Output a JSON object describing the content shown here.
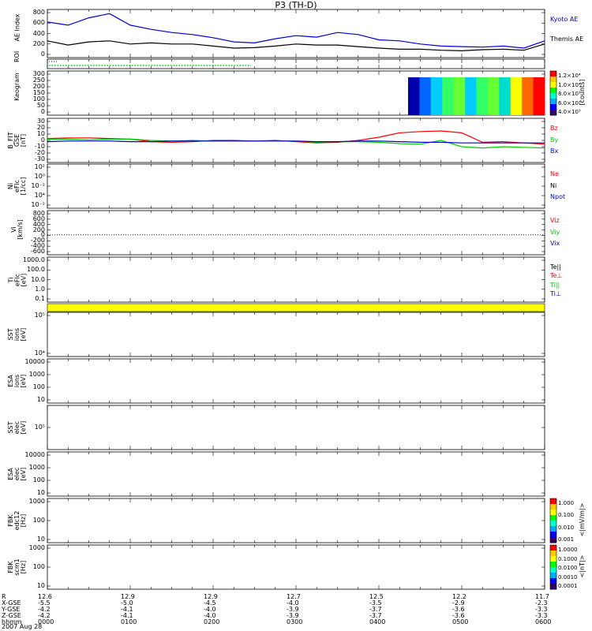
{
  "title": "P3 (TH-D)",
  "date": "2007 Aug 28",
  "colors": {
    "blue": "#0000cc",
    "green": "#00cc00",
    "red": "#ff0000",
    "black": "#000000",
    "yellow": "#ffff00"
  },
  "panels": [
    {
      "id": "ae",
      "ylabel": [
        "AE Index"
      ],
      "ticks": [
        "800",
        "600",
        "400",
        "200",
        "0"
      ],
      "legend": [
        {
          "text": "Kyoto AE",
          "color": "blue"
        },
        {
          "text": "Themis AE",
          "color": "black"
        }
      ]
    },
    {
      "id": "roi",
      "ylabel": [
        "ROI"
      ],
      "ticks": [],
      "legend": []
    },
    {
      "id": "keogram",
      "ylabel": [
        "Keogram"
      ],
      "ticks": [
        "300",
        "250",
        "200",
        "150",
        "100",
        "50",
        "0"
      ],
      "legend": [],
      "colorbar": {
        "label": "[counts]",
        "ticks": [
          "1.2×10⁴",
          "1.0×10⁴",
          "8.0×10³",
          "6.0×10³",
          "4.0×10³"
        ]
      }
    },
    {
      "id": "bfit",
      "ylabel": [
        "B_FIT",
        "GSE",
        "[nT]"
      ],
      "ticks": [
        "30",
        "20",
        "10",
        "0",
        "-10",
        "-20",
        "-30"
      ],
      "legend": [
        {
          "text": "Bz",
          "color": "red"
        },
        {
          "text": "By",
          "color": "green"
        },
        {
          "text": "Bx",
          "color": "blue"
        }
      ]
    },
    {
      "id": "ni",
      "ylabel": [
        "Ni",
        "eFlc",
        "[1/cc]"
      ],
      "ticks": [
        "10²",
        "10⁰",
        "10⁻²",
        "10⁴",
        "10⁻²"
      ],
      "legend": [
        {
          "text": "Ne",
          "color": "red"
        },
        {
          "text": "Ni",
          "color": "black"
        },
        {
          "text": "Npot",
          "color": "blue"
        }
      ]
    },
    {
      "id": "vi",
      "ylabel": [
        "Vi",
        "[km/s]"
      ],
      "ticks": [
        "800",
        "600",
        "400",
        "200",
        "0",
        "-200",
        "-400",
        "-600"
      ],
      "legend": [
        {
          "text": "Viz",
          "color": "red"
        },
        {
          "text": "Viy",
          "color": "green"
        },
        {
          "text": "Vix",
          "color": "blue"
        }
      ]
    },
    {
      "id": "ti",
      "ylabel": [
        "Ti",
        "eFlc",
        "[eV]"
      ],
      "ticks": [
        "1000.0",
        "100.0",
        "10.0",
        "1.0",
        "0.1"
      ],
      "legend": [
        {
          "text": "Te||",
          "color": "black"
        },
        {
          "text": "Te⊥",
          "color": "red"
        },
        {
          "text": "Ti||",
          "color": "green"
        },
        {
          "text": "Ti⊥",
          "color": "blue"
        }
      ]
    },
    {
      "id": "sst1",
      "ylabel": [
        "SST",
        "ions",
        "[eV]"
      ],
      "ticks": [
        "10⁵",
        "10⁴"
      ],
      "legend": []
    },
    {
      "id": "esa1",
      "ylabel": [
        "ESA",
        "ions",
        "[eV]"
      ],
      "ticks": [
        "10000",
        "1000",
        "100",
        "10"
      ],
      "legend": []
    },
    {
      "id": "sst2",
      "ylabel": [
        "SST",
        "elec",
        "[eV]"
      ],
      "ticks": [
        "10⁵"
      ],
      "legend": []
    },
    {
      "id": "esa2",
      "ylabel": [
        "ESA",
        "elec",
        "[eV]"
      ],
      "ticks": [
        "10000",
        "1000",
        "100",
        "10"
      ],
      "legend": []
    },
    {
      "id": "fbk1",
      "ylabel": [
        "FBK",
        "edc12",
        "[Hz]"
      ],
      "ticks": [
        "1000",
        "100",
        "10"
      ],
      "legend": [],
      "colorbar": {
        "label": "<|mV/m|>",
        "ticks": [
          "1.000",
          "0.100",
          "0.010",
          "0.001"
        ]
      }
    },
    {
      "id": "fbk2",
      "ylabel": [
        "FBK",
        "scm1",
        "[Hz]"
      ],
      "ticks": [
        "1000",
        "100",
        "10"
      ],
      "legend": [],
      "colorbar": {
        "label": "<|nT|>",
        "ticks": [
          "1.0000",
          "0.1000",
          "0.0100",
          "0.0010",
          "0.0001"
        ]
      }
    }
  ],
  "xaxis": {
    "rowlabels": [
      "R",
      "X-GSE",
      "Y-GSE",
      "Z-GSE",
      "hhmm"
    ],
    "columns": [
      {
        "R": "12.6",
        "X": "-5.5",
        "Y": "-4.2",
        "Z": "-4.2",
        "t": "0000"
      },
      {
        "R": "12.9",
        "X": "-5.0",
        "Y": "-4.1",
        "Z": "-4.1",
        "t": "0100"
      },
      {
        "R": "12.9",
        "X": "-4.5",
        "Y": "-4.0",
        "Z": "-4.0",
        "t": "0200"
      },
      {
        "R": "12.7",
        "X": "-4.0",
        "Y": "-3.9",
        "Z": "-3.9",
        "t": "0300"
      },
      {
        "R": "12.5",
        "X": "-3.5",
        "Y": "-3.7",
        "Z": "-3.7",
        "t": "0400"
      },
      {
        "R": "12.2",
        "X": "-2.9",
        "Y": "-3.6",
        "Z": "-3.6",
        "t": "0500"
      },
      {
        "R": "11.7",
        "X": "-2.3",
        "Y": "-3.3",
        "Z": "-3.3",
        "t": "0600"
      }
    ]
  },
  "chart_data": {
    "type": "line",
    "x_hours": [
      0,
      0.25,
      0.5,
      0.75,
      1.0,
      1.25,
      1.5,
      1.75,
      2.0,
      2.25,
      2.5,
      2.75,
      3.0,
      3.25,
      3.5,
      3.75,
      4.0,
      4.25,
      4.5,
      4.75,
      5.0,
      5.25,
      5.5,
      5.75,
      6.0
    ],
    "series": [
      {
        "panel": "ae",
        "name": "Kyoto AE",
        "color": "blue",
        "values": [
          620,
          560,
          700,
          780,
          560,
          480,
          420,
          380,
          320,
          240,
          220,
          300,
          360,
          330,
          420,
          380,
          280,
          260,
          200,
          160,
          150,
          140,
          160,
          120,
          260
        ]
      },
      {
        "panel": "ae",
        "name": "Themis AE",
        "color": "black",
        "values": [
          260,
          180,
          240,
          260,
          200,
          220,
          200,
          200,
          160,
          120,
          130,
          160,
          200,
          180,
          180,
          150,
          120,
          100,
          100,
          80,
          70,
          90,
          100,
          80,
          200
        ]
      },
      {
        "panel": "bfit",
        "name": "Bz",
        "color": "red",
        "values": [
          3,
          4,
          4,
          3,
          2,
          -2,
          -3,
          -2,
          0,
          0,
          -1,
          0,
          -2,
          -4,
          -3,
          0,
          5,
          12,
          14,
          15,
          12,
          -3,
          -2,
          -4,
          -6
        ]
      },
      {
        "panel": "bfit",
        "name": "By",
        "color": "green",
        "values": [
          2,
          2,
          1,
          2,
          2,
          0,
          -1,
          0,
          -1,
          -1,
          -1,
          -1,
          -1,
          -3,
          -2,
          -2,
          -3,
          -5,
          -6,
          0,
          -10,
          -12,
          -10,
          -11,
          -12
        ]
      },
      {
        "panel": "bfit",
        "name": "Bx",
        "color": "blue",
        "values": [
          -2,
          -1,
          -1,
          -1,
          -2,
          -2,
          -1,
          -1,
          -1,
          -1,
          -1,
          -1,
          -1,
          -2,
          -2,
          -1,
          -1,
          -2,
          -3,
          -3,
          -4,
          -4,
          -4,
          -4,
          -4
        ]
      }
    ],
    "ae_ylim": [
      0,
      800
    ],
    "bfit_ylim": [
      -30,
      30
    ]
  }
}
